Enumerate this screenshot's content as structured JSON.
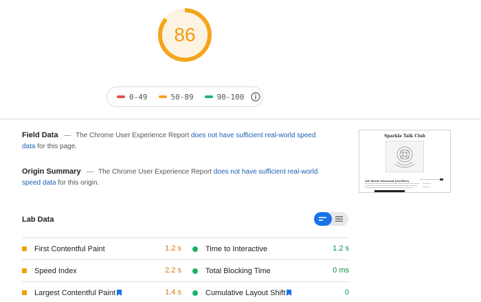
{
  "score": {
    "value": "86",
    "fraction": 0.86,
    "color": "#f4a51c"
  },
  "legend": {
    "items": [
      {
        "label": "0-49",
        "color": "#e0524a"
      },
      {
        "label": "50-89",
        "color": "#f4a51c"
      },
      {
        "label": "90-100",
        "color": "#1fb573"
      }
    ],
    "info_icon": "info-circle-icon"
  },
  "field_data": {
    "title": "Field Data",
    "text_before": "The Chrome User Experience Report",
    "link": "does not have sufficient real-world speed data",
    "text_after": "for this page."
  },
  "origin_summary": {
    "title": "Origin Summary",
    "text_before": "The Chrome User Experience Report",
    "link": "does not have sufficient real-world speed data",
    "text_after": "for this origin."
  },
  "thumbnail": {
    "site_title": "Sparkle Talk Club",
    "heading": "All About Diamond Jewellery"
  },
  "lab_data": {
    "title": "Lab Data",
    "toggle_icons": [
      "bar-view-icon",
      "list-view-icon"
    ],
    "metrics_left": [
      {
        "name": "First Contentful Paint",
        "value": "1.2 s",
        "flag": false
      },
      {
        "name": "Speed Index",
        "value": "2.2 s",
        "flag": false
      },
      {
        "name": "Largest Contentful Paint",
        "value": "1.4 s",
        "flag": true
      }
    ],
    "metrics_right": [
      {
        "name": "Time to Interactive",
        "value": "1.2 s",
        "flag": false
      },
      {
        "name": "Total Blocking Time",
        "value": "0 ms",
        "flag": false
      },
      {
        "name": "Cumulative Layout Shift",
        "value": "0",
        "flag": true
      }
    ]
  }
}
